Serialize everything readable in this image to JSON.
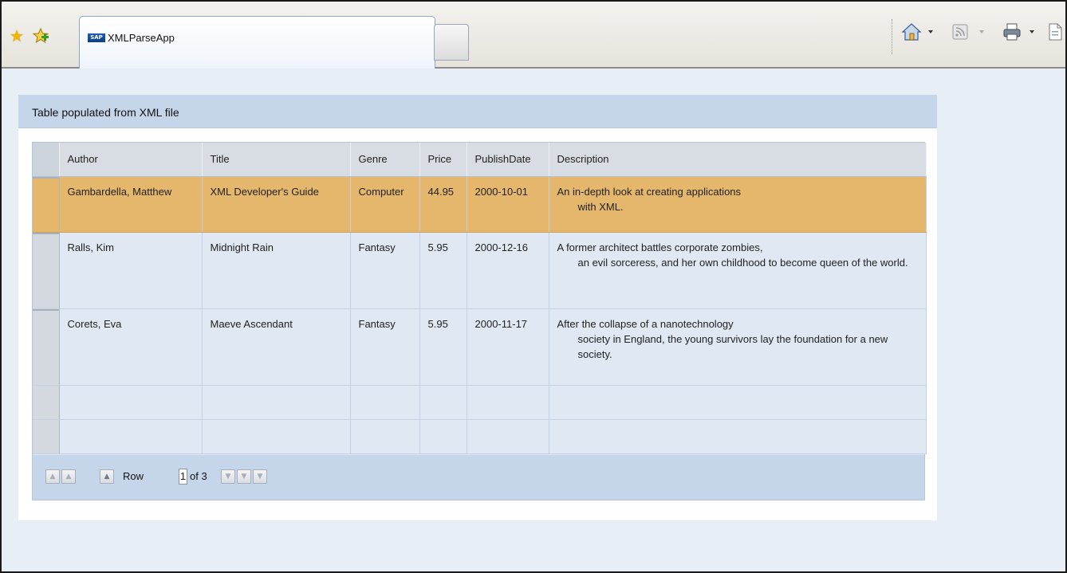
{
  "browser": {
    "tab_title": "XMLParseApp",
    "tab_logo": "SAP"
  },
  "panel": {
    "title": "Table populated from XML file"
  },
  "table": {
    "columns": [
      "Author",
      "Title",
      "Genre",
      "Price",
      "PublishDate",
      "Description"
    ],
    "rows": [
      {
        "author": "Gambardella, Matthew",
        "title": "XML Developer's Guide",
        "genre": "Computer",
        "price": "44.95",
        "publish_date": "2000-10-01",
        "description_first": "An in-depth look at creating applications",
        "description_rest": "with XML.",
        "selected": true
      },
      {
        "author": "Ralls, Kim",
        "title": "Midnight Rain",
        "genre": "Fantasy",
        "price": "5.95",
        "publish_date": "2000-12-16",
        "description_first": "A former architect battles corporate zombies,",
        "description_rest": "an evil sorceress, and her own childhood to become queen of the world.",
        "selected": false
      },
      {
        "author": "Corets, Eva",
        "title": "Maeve Ascendant",
        "genre": "Fantasy",
        "price": "5.95",
        "publish_date": "2000-11-17",
        "description_first": "After the collapse of a nanotechnology",
        "description_rest": "society in England, the young survivors lay the foundation for a new society.",
        "selected": false
      }
    ]
  },
  "pager": {
    "row_label": "Row",
    "current_row": "1",
    "of_label": "of 3"
  },
  "colors": {
    "selected_row": "#e4b76c",
    "header_band": "#c5d6ea",
    "row_background": "#dfe8f3"
  },
  "icons": {
    "favorites": "star-icon",
    "add_favorites": "add-favorites-icon",
    "home": "home-icon",
    "feeds": "rss-feed-icon",
    "print": "printer-icon",
    "page": "page-icon"
  }
}
